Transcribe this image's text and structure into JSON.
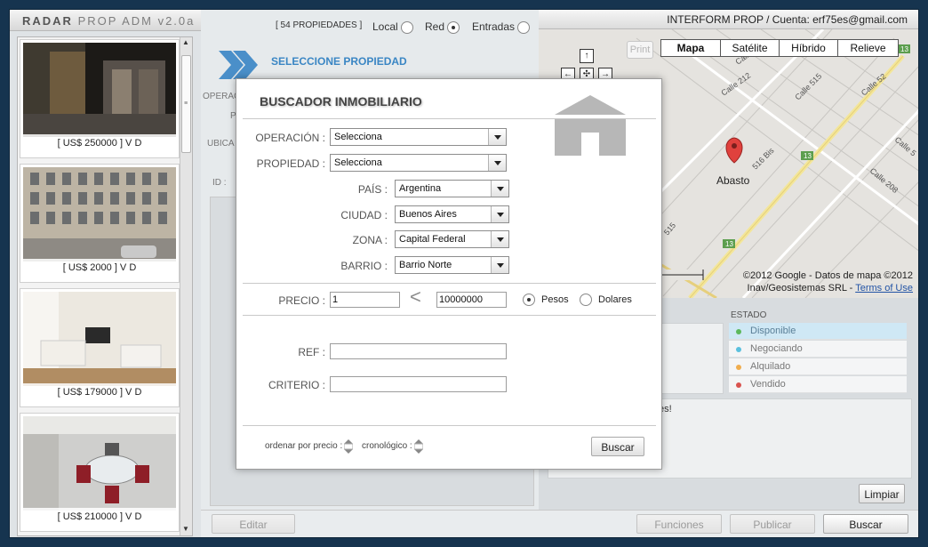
{
  "app": {
    "title_bold": "RADAR",
    "title_rest": "PROP ADM v2.0a"
  },
  "listings": [
    {
      "price": "[ US$ 250000 ] V D"
    },
    {
      "price": "[ US$ 2000 ] V D"
    },
    {
      "price": "[ US$ 179000 ] V D"
    },
    {
      "price": "[ US$ 210000 ] V D"
    }
  ],
  "filters": {
    "count": "[ 54 PROPIEDADES ]",
    "local": "Local",
    "red": "Red",
    "entradas": "Entradas",
    "selected": "Red"
  },
  "middle": {
    "select_title": "SELECCIONE PROPIEDAD",
    "ghost_operac": "OPERAC",
    "ghost_pr": "PR",
    "ghost_ubica": "UBICA",
    "ghost_id": "ID :",
    "edit_label": "Editar"
  },
  "right": {
    "account": "INTERFORM PROP / Cuenta: erf75es@gmail.com",
    "print": "Print",
    "map_tabs": [
      "Mapa",
      "Satélite",
      "Híbrido",
      "Relieve"
    ],
    "active_tab": "Mapa",
    "marker_label": "Abasto",
    "streets": [
      "Calle 208",
      "Calle 212",
      "Calle 515",
      "Calle 52",
      "Calle 5",
      "Calle 208",
      "516 Bis",
      "515",
      "13",
      "13",
      "13"
    ],
    "copyright": "©2012 Google - Datos de mapa ©2012",
    "copyright2": "Inav/Geosistemas SRL -",
    "terms": "Terms of Use",
    "estado_label": "ESTADO",
    "estados": [
      {
        "label": "Disponible",
        "color": "#5cb85c"
      },
      {
        "label": "Negociando",
        "color": "#5bc0de"
      },
      {
        "label": "Alquilado",
        "color": "#f0ad4e"
      },
      {
        "label": "Vendido",
        "color": "#d9534f"
      }
    ],
    "notes_text": "es!",
    "limpiar": "Limpiar",
    "funciones": "Funciones",
    "publicar": "Publicar",
    "buscar": "Buscar"
  },
  "modal": {
    "title": "BUSCADOR INMOBILIARIO",
    "operacion_label": "OPERACIÓN :",
    "operacion_value": "Selecciona",
    "propiedad_label": "PROPIEDAD :",
    "propiedad_value": "Selecciona",
    "pais_label": "PAÍS :",
    "pais_value": "Argentina",
    "ciudad_label": "CIUDAD :",
    "ciudad_value": "Buenos Aires",
    "zona_label": "ZONA :",
    "zona_value": "Capital Federal",
    "barrio_label": "BARRIO :",
    "barrio_value": "Barrio Norte",
    "precio_label": "PRECIO :",
    "precio_min": "1",
    "precio_max": "10000000",
    "lt": "<",
    "pesos": "Pesos",
    "dolares": "Dolares",
    "currency_selected": "Pesos",
    "ref_label": "REF :",
    "ref_value": "",
    "criterio_label": "CRITERIO :",
    "criterio_value": "",
    "ordenar": "ordenar por precio :",
    "cronologico": "cronológico :",
    "buscar": "Buscar"
  }
}
